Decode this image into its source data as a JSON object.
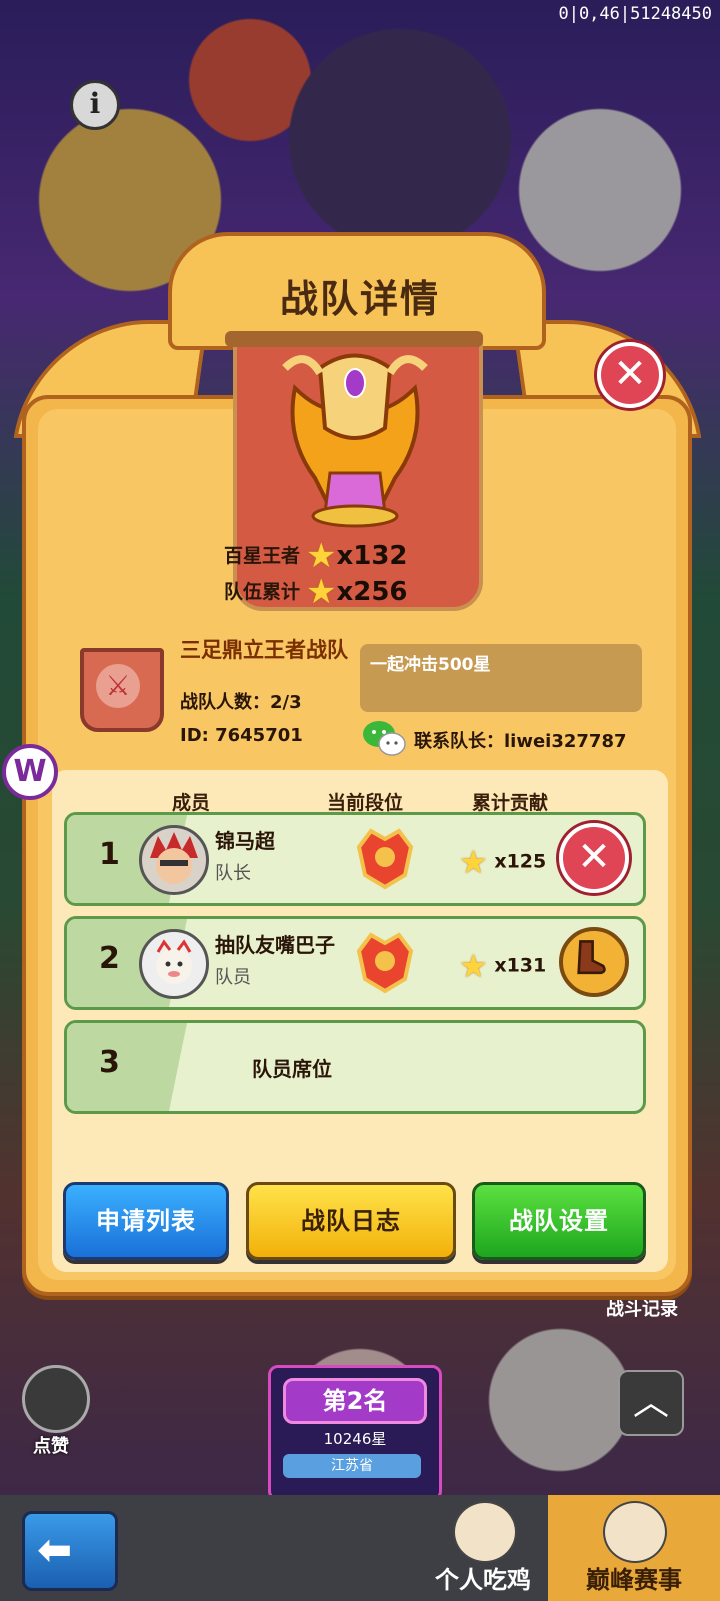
{
  "status_bar": {
    "text": "0|0,46|51248450"
  },
  "dialog": {
    "title": "战队详情",
    "stats": [
      {
        "label": "百星王者",
        "value": "x132"
      },
      {
        "label": "队伍累计",
        "value": "x256"
      }
    ],
    "team": {
      "name": "三足鼎立王者战队",
      "member_count": "战队人数：2/3",
      "id": "ID: 7645701",
      "motto": "一起冲击500星",
      "contact": "联系队长：liwei327787"
    },
    "table": {
      "headers": [
        "成员",
        "当前段位",
        "累计贡献"
      ],
      "members": [
        {
          "rank": "1",
          "name": "锦马超",
          "role": "队长",
          "contribution": "x125"
        },
        {
          "rank": "2",
          "name": "抽队友嘴巴子",
          "role": "队员",
          "contribution": "x131"
        }
      ],
      "empty_seat": {
        "rank": "3",
        "label": "队员席位"
      }
    },
    "buttons": {
      "apply_list": "申请列表",
      "team_log": "战队日志",
      "team_settings": "战队设置"
    }
  },
  "background": {
    "like_label": "点赞",
    "rank_card": {
      "place": "第2名",
      "stars": "10246星",
      "province": "江苏省"
    },
    "side_label": "战斗记录"
  },
  "nav": {
    "tabs": [
      "个人吃鸡",
      "巅峰赛事"
    ],
    "active_tab": "巅峰赛事"
  },
  "colors": {
    "panel": "#f3b64a",
    "accent_red": "#e04556",
    "btn_blue": "#1a70d8",
    "btn_yellow": "#f2b10a",
    "btn_green": "#1da61e"
  }
}
